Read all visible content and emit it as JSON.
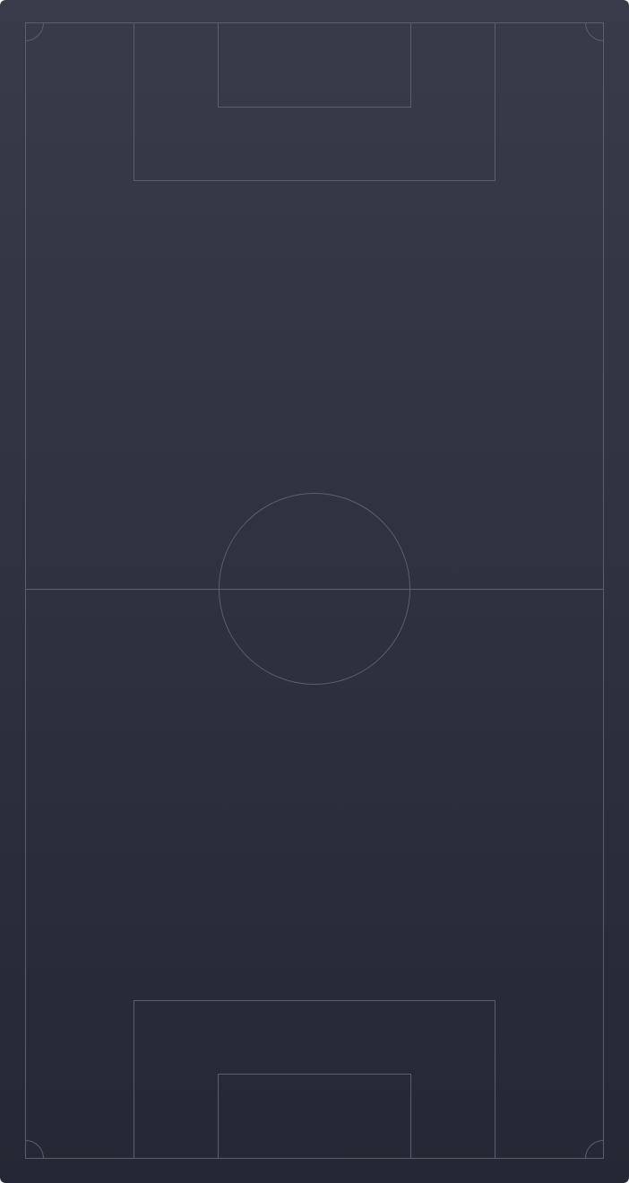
{
  "colors": {
    "background_top": "#393b4b",
    "background_bottom": "#252734",
    "line": "#5c5e70"
  },
  "pitch": {
    "surface": "football pitch",
    "orientation": "vertical"
  }
}
